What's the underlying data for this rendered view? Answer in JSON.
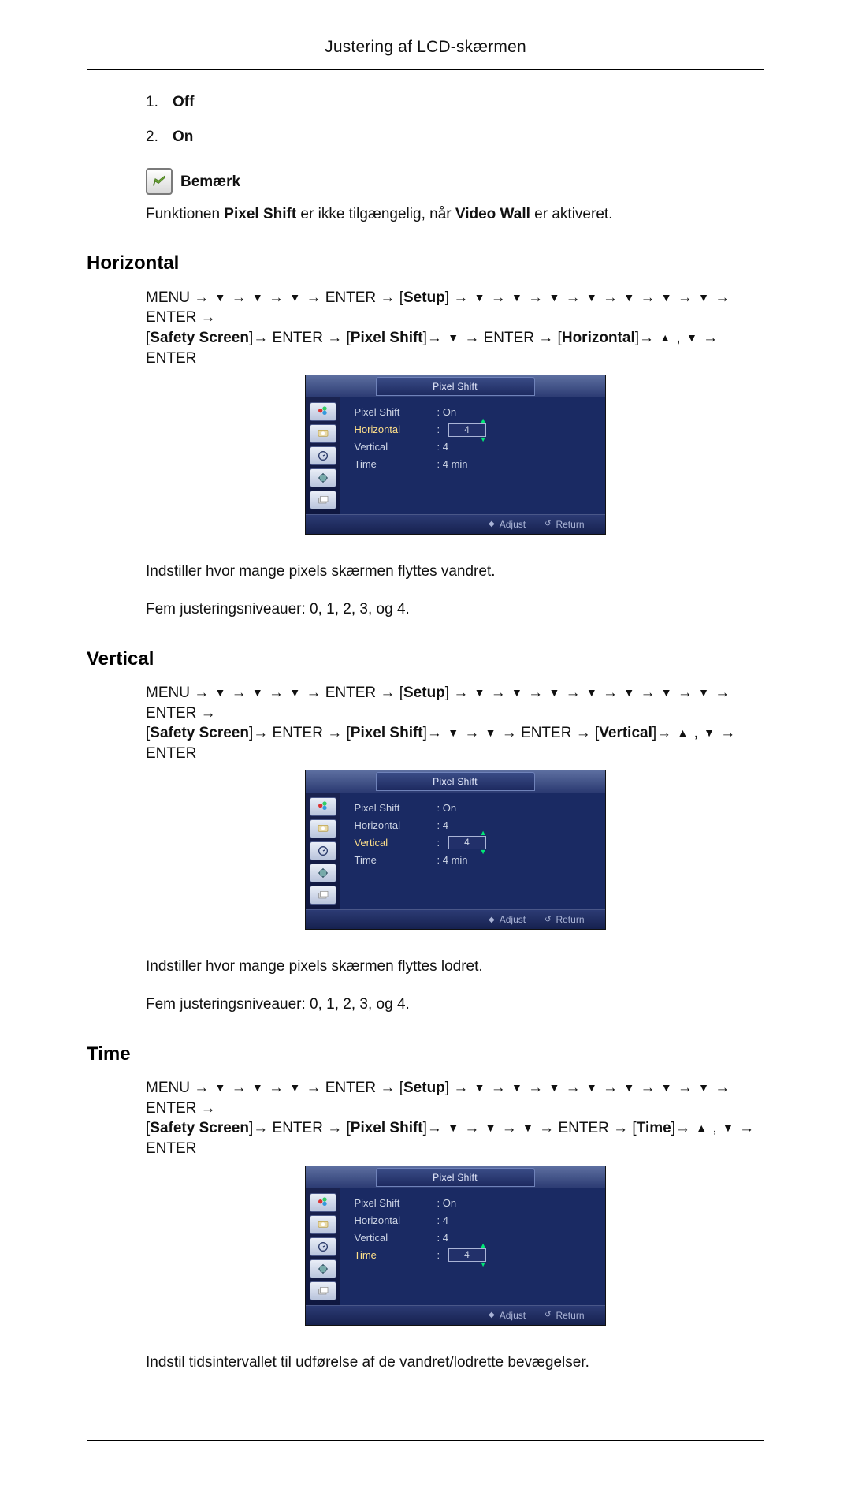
{
  "page_title": "Justering af LCD-skærmen",
  "options": [
    "Off",
    "On"
  ],
  "note_label": "Bemærk",
  "note_text_parts": [
    "Funktionen ",
    "Pixel Shift",
    " er ikke tilgængelig, når ",
    "Video Wall",
    " er aktiveret."
  ],
  "sections": {
    "horizontal": {
      "heading": "Horizontal",
      "nav_l1": {
        "prefix": "MENU → ",
        "down_groups": 3,
        "enter1": "ENTER",
        "setup": "Setup",
        "down_groups2": 7,
        "enter2": "ENTER"
      },
      "nav_l2": {
        "safety": "Safety Screen",
        "enter1": "ENTER",
        "pixel": "Pixel Shift",
        "down": 1,
        "enter2": "ENTER",
        "target": "Horizontal",
        "updown": true,
        "enter3": "ENTER"
      },
      "osd": {
        "title": "Pixel Shift",
        "rows": [
          {
            "label": "Pixel Shift",
            "value": ": On"
          },
          {
            "label": "Horizontal",
            "highlight": true,
            "boxed": "4"
          },
          {
            "label": "Vertical",
            "value": ": 4"
          },
          {
            "label": "Time",
            "value": ": 4 min"
          }
        ],
        "footer": {
          "adjust": "Adjust",
          "ret": "Return"
        }
      },
      "desc1": "Indstiller hvor mange pixels skærmen flyttes vandret.",
      "desc2": "Fem justeringsniveauer: 0, 1, 2, 3, og 4."
    },
    "vertical": {
      "heading": "Vertical",
      "nav_l1": {
        "prefix": "MENU → ",
        "down_groups": 3,
        "enter1": "ENTER",
        "setup": "Setup",
        "down_groups2": 7,
        "enter2": "ENTER"
      },
      "nav_l2": {
        "safety": "Safety Screen",
        "enter1": "ENTER",
        "pixel": "Pixel Shift",
        "down": 2,
        "enter2": "ENTER",
        "target": "Vertical",
        "updown": true,
        "enter3": "ENTER"
      },
      "osd": {
        "title": "Pixel Shift",
        "rows": [
          {
            "label": "Pixel Shift",
            "value": ": On"
          },
          {
            "label": "Horizontal",
            "value": ": 4"
          },
          {
            "label": "Vertical",
            "highlight": true,
            "boxed": "4"
          },
          {
            "label": "Time",
            "value": ": 4 min"
          }
        ],
        "footer": {
          "adjust": "Adjust",
          "ret": "Return"
        }
      },
      "desc1": "Indstiller hvor mange pixels skærmen flyttes lodret.",
      "desc2": "Fem justeringsniveauer: 0, 1, 2, 3, og 4."
    },
    "time": {
      "heading": "Time",
      "nav_l1": {
        "prefix": "MENU → ",
        "down_groups": 3,
        "enter1": "ENTER",
        "setup": "Setup",
        "down_groups2": 7,
        "enter2": "ENTER"
      },
      "nav_l2": {
        "safety": "Safety Screen",
        "enter1": "ENTER",
        "pixel": "Pixel Shift",
        "down": 3,
        "enter2": "ENTER",
        "target": "Time",
        "updown": true,
        "enter3": "ENTER"
      },
      "osd": {
        "title": "Pixel Shift",
        "rows": [
          {
            "label": "Pixel Shift",
            "value": ": On"
          },
          {
            "label": "Horizontal",
            "value": ": 4"
          },
          {
            "label": "Vertical",
            "value": ": 4"
          },
          {
            "label": "Time",
            "highlight": true,
            "boxed": "4"
          }
        ],
        "footer": {
          "adjust": "Adjust",
          "ret": "Return"
        }
      },
      "desc1": "Indstil tidsintervallet til udførelse af de vandret/lodrette bevægelser."
    }
  }
}
